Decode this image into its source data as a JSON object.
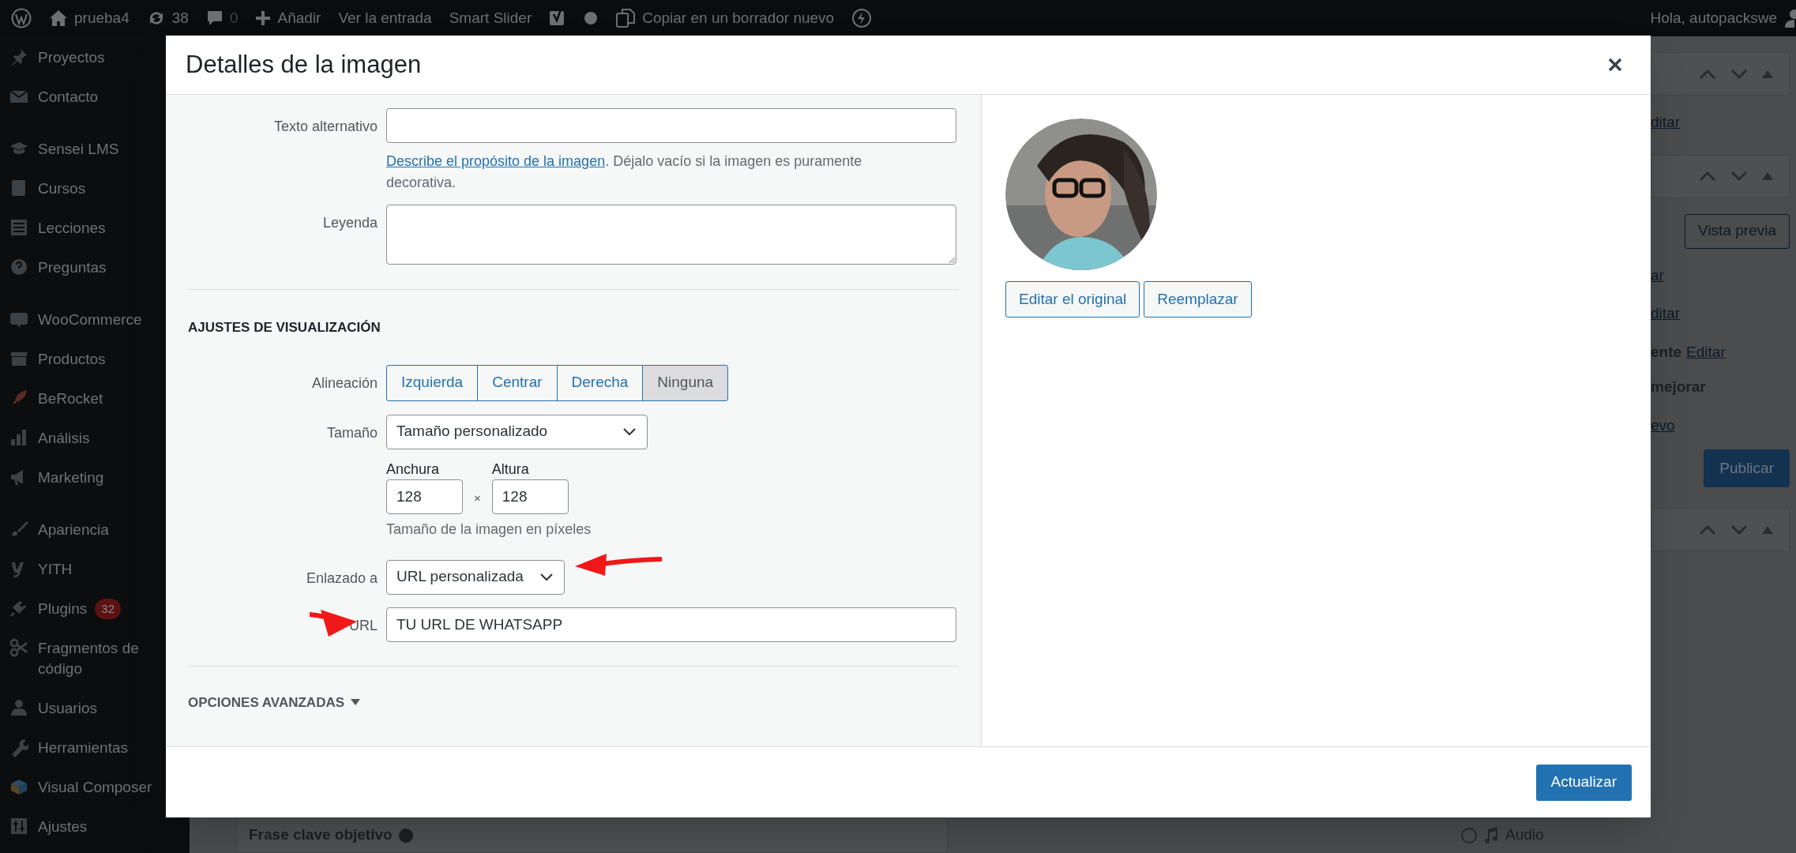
{
  "admin_bar": {
    "items": [
      {
        "kind": "logo"
      },
      {
        "kind": "site",
        "label": "prueba4"
      },
      {
        "kind": "updates",
        "label": "38"
      },
      {
        "kind": "comments",
        "label": "0"
      },
      {
        "kind": "new",
        "label": "Añadir"
      },
      {
        "kind": "text",
        "label": "Ver la entrada"
      },
      {
        "kind": "text",
        "label": "Smart Slider"
      },
      {
        "kind": "yoast"
      },
      {
        "kind": "dot"
      },
      {
        "kind": "copy",
        "label": "Copiar en un borrador nuevo"
      },
      {
        "kind": "bolt"
      }
    ],
    "greeting": "Hola, autopackswe"
  },
  "sidebar": {
    "groups": [
      [
        {
          "label": "Proyectos",
          "kind": "pin"
        },
        {
          "label": "Contacto",
          "kind": "mail"
        }
      ],
      [
        {
          "label": "Sensei LMS",
          "kind": "cap"
        },
        {
          "label": "Cursos",
          "kind": "book"
        },
        {
          "label": "Lecciones",
          "kind": "list"
        },
        {
          "label": "Preguntas",
          "kind": "help"
        }
      ],
      [
        {
          "label": "WooCommerce",
          "kind": "woo"
        },
        {
          "label": "Productos",
          "kind": "box"
        },
        {
          "label": "BeRocket",
          "kind": "rocket"
        },
        {
          "label": "Análisis",
          "kind": "bars"
        },
        {
          "label": "Marketing",
          "kind": "megaphone"
        }
      ],
      [
        {
          "label": "Apariencia",
          "kind": "brush"
        },
        {
          "label": "YITH",
          "kind": "yith"
        },
        {
          "label": "Plugins",
          "kind": "plug",
          "badge": "32"
        },
        {
          "label": "Fragmentos de código",
          "kind": "scissors"
        },
        {
          "label": "Usuarios",
          "kind": "user"
        },
        {
          "label": "Herramientas",
          "kind": "wrench"
        },
        {
          "label": "Visual Composer",
          "kind": "cube"
        },
        {
          "label": "Ajustes",
          "kind": "sliders"
        }
      ]
    ]
  },
  "background": {
    "right_fragments": [
      {
        "kind": "header"
      },
      {
        "kind": "link",
        "text": "ditar"
      },
      {
        "kind": "header"
      },
      {
        "kind": "button",
        "text": "Vista previa"
      },
      {
        "kind": "link",
        "text": "ar"
      },
      {
        "kind": "link",
        "text": "ditar"
      },
      {
        "kind": "mixed",
        "text": "ente",
        "link": "Editar"
      },
      {
        "kind": "bold",
        "text": "mejorar"
      },
      {
        "kind": "link",
        "text": "evo"
      },
      {
        "kind": "primary",
        "text": "Publicar"
      },
      {
        "kind": "header"
      }
    ],
    "focus_keyphrase": "Frase clave objetivo",
    "format_option": {
      "label": "Audio",
      "selected": false
    }
  },
  "modal": {
    "title": "Detalles de la imagen",
    "alt_text": {
      "label": "Texto alternativo",
      "help_link": "Describe el propósito de la imagen",
      "help_text": ". Déjalo vacío si la imagen es puramente decorativa."
    },
    "caption": {
      "label": "Leyenda"
    },
    "display_settings": {
      "heading": "AJUSTES DE VISUALIZACIÓN",
      "alignment": {
        "label": "Alineación",
        "options": [
          {
            "label": "Izquierda",
            "selected": false
          },
          {
            "label": "Centrar",
            "selected": false
          },
          {
            "label": "Derecha",
            "selected": false
          },
          {
            "label": "Ninguna",
            "selected": true
          }
        ]
      },
      "size": {
        "label": "Tamaño",
        "value": "Tamaño personalizado"
      },
      "dimensions": {
        "width_label": "Anchura",
        "width_value": "128",
        "separator": "×",
        "height_label": "Altura",
        "height_value": "128",
        "help": "Tamaño de la imagen en píxeles"
      },
      "link_to": {
        "label": "Enlazado a",
        "value": "URL personalizada"
      },
      "url": {
        "label": "URL",
        "value": "TU URL DE WHATSAPP"
      }
    },
    "advanced": {
      "label": "OPCIONES AVANZADAS",
      "expanded": false
    },
    "preview_buttons": [
      "Editar el original",
      "Reemplazar"
    ],
    "footer_button": "Actualizar"
  }
}
